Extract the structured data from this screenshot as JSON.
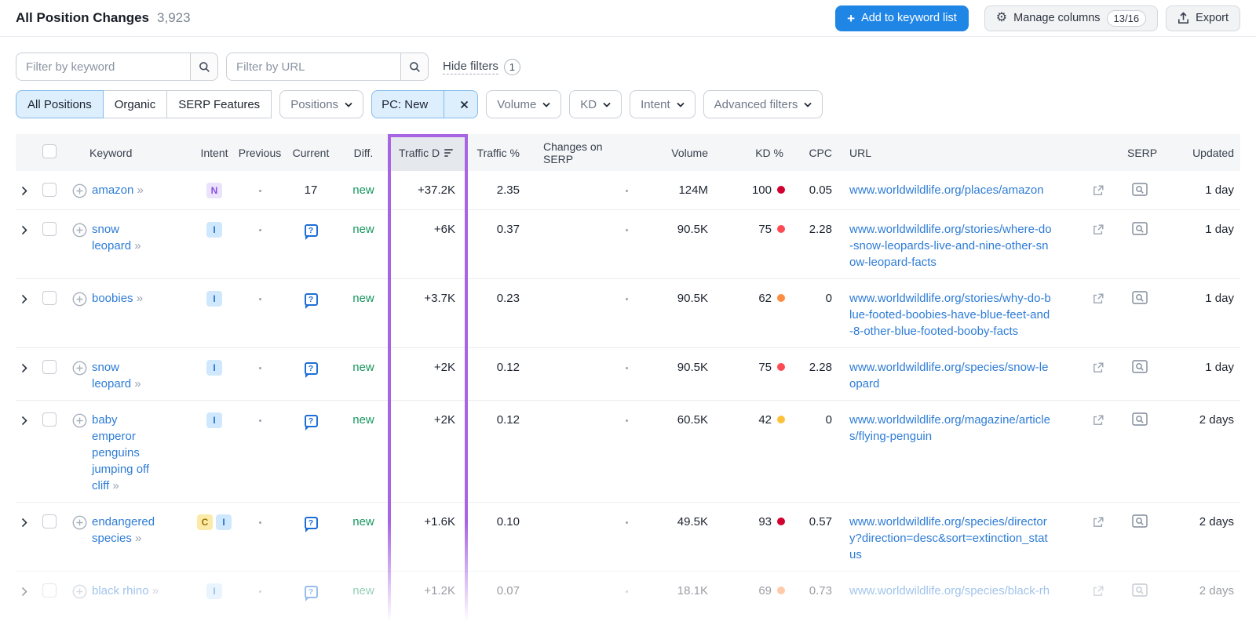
{
  "page": {
    "title": "All Position Changes",
    "count": "3,923"
  },
  "toolbar": {
    "add_to_list": "Add to keyword list",
    "manage_columns": "Manage columns",
    "manage_columns_count": "13/16",
    "export": "Export"
  },
  "filters": {
    "keyword_placeholder": "Filter by keyword",
    "url_placeholder": "Filter by URL",
    "hide_filters": "Hide filters",
    "hide_filters_count": "1",
    "segments": [
      "All Positions",
      "Organic",
      "SERP Features"
    ],
    "active_segment": "All Positions",
    "chips": {
      "positions": "Positions",
      "pc_new": "PC: New",
      "volume": "Volume",
      "kd": "KD",
      "intent": "Intent",
      "advanced": "Advanced filters"
    }
  },
  "icons": {
    "keyword_arrows": "»",
    "question": "?",
    "plus": "+",
    "gear": "⚙"
  },
  "colors": {
    "accent_blue": "#2086e6",
    "link_blue": "#2e7cd6",
    "new_green": "#17975f",
    "highlight_purple": "#a765e4"
  },
  "table": {
    "headers": {
      "keyword": "Keyword",
      "intent": "Intent",
      "previous": "Previous",
      "current": "Current",
      "diff": "Diff.",
      "traffic_diff": "Traffic D",
      "traffic_pct": "Traffic %",
      "changes_on_serp": "Changes on SERP",
      "volume": "Volume",
      "kd": "KD %",
      "cpc": "CPC",
      "url": "URL",
      "serp": "SERP",
      "updated": "Updated"
    },
    "highlight_color": "#a765e4",
    "intent_colors": {
      "N": {
        "bg": "#ebe2fc",
        "fg": "#8a4fe0"
      },
      "I": {
        "bg": "#cfe8fd",
        "fg": "#2271cf"
      },
      "C": {
        "bg": "#fceaa8",
        "fg": "#9c7400"
      }
    },
    "rows": [
      {
        "keyword": "amazon",
        "intents": [
          "N"
        ],
        "previous": "dot",
        "current": {
          "type": "number",
          "value": "17"
        },
        "diff": "new",
        "traffic_diff": "+37.2K",
        "traffic_pct": "2.35",
        "changes_on_serp": "dot",
        "volume": "124M",
        "kd": "100",
        "kd_color": "#d1002f",
        "cpc": "0.05",
        "url": "www.worldwildlife.org/places/amazon",
        "updated": "1 day",
        "faded": false
      },
      {
        "keyword": "snow leopard",
        "intents": [
          "I"
        ],
        "previous": "dot",
        "current": {
          "type": "serp_feature"
        },
        "diff": "new",
        "traffic_diff": "+6K",
        "traffic_pct": "0.37",
        "changes_on_serp": "dot",
        "volume": "90.5K",
        "kd": "75",
        "kd_color": "#ff4953",
        "cpc": "2.28",
        "url": "www.worldwildlife.org/stories/where-do-snow-leopards-live-and-nine-other-snow-leopard-facts",
        "updated": "1 day",
        "faded": false
      },
      {
        "keyword": "boobies",
        "intents": [
          "I"
        ],
        "previous": "dot",
        "current": {
          "type": "serp_feature"
        },
        "diff": "new",
        "traffic_diff": "+3.7K",
        "traffic_pct": "0.23",
        "changes_on_serp": "dot",
        "volume": "90.5K",
        "kd": "62",
        "kd_color": "#ff8c43",
        "cpc": "0",
        "url": "www.worldwildlife.org/stories/why-do-blue-footed-boobies-have-blue-feet-and-8-other-blue-footed-booby-facts",
        "updated": "1 day",
        "faded": false
      },
      {
        "keyword": "snow leopard",
        "intents": [
          "I"
        ],
        "previous": "dot",
        "current": {
          "type": "serp_feature"
        },
        "diff": "new",
        "traffic_diff": "+2K",
        "traffic_pct": "0.12",
        "changes_on_serp": "dot",
        "volume": "90.5K",
        "kd": "75",
        "kd_color": "#ff4953",
        "cpc": "2.28",
        "url": "www.worldwildlife.org/species/snow-leopard",
        "updated": "1 day",
        "faded": false
      },
      {
        "keyword": "baby emperor penguins jumping off cliff",
        "intents": [
          "I"
        ],
        "previous": "dot",
        "current": {
          "type": "serp_feature"
        },
        "diff": "new",
        "traffic_diff": "+2K",
        "traffic_pct": "0.12",
        "changes_on_serp": "dot",
        "volume": "60.5K",
        "kd": "42",
        "kd_color": "#fdc23c",
        "cpc": "0",
        "url": "www.worldwildlife.org/magazine/articles/flying-penguin",
        "updated": "2 days",
        "faded": false
      },
      {
        "keyword": "endangered species",
        "intents": [
          "C",
          "I"
        ],
        "previous": "dot",
        "current": {
          "type": "serp_feature"
        },
        "diff": "new",
        "traffic_diff": "+1.6K",
        "traffic_pct": "0.10",
        "changes_on_serp": "dot",
        "volume": "49.5K",
        "kd": "93",
        "kd_color": "#d1002f",
        "cpc": "0.57",
        "url": "www.worldwildlife.org/species/directory?direction=desc&sort=extinction_status",
        "updated": "2 days",
        "faded": false
      },
      {
        "keyword": "black rhino",
        "intents": [
          "I"
        ],
        "previous": "dot",
        "current": {
          "type": "serp_feature"
        },
        "diff": "new",
        "traffic_diff": "+1.2K",
        "traffic_pct": "0.07",
        "changes_on_serp": "dot",
        "volume": "18.1K",
        "kd": "69",
        "kd_color": "#ff8c43",
        "cpc": "0.73",
        "url": "www.worldwildlife.org/species/black-rh",
        "updated": "2 days",
        "faded": true
      }
    ]
  }
}
